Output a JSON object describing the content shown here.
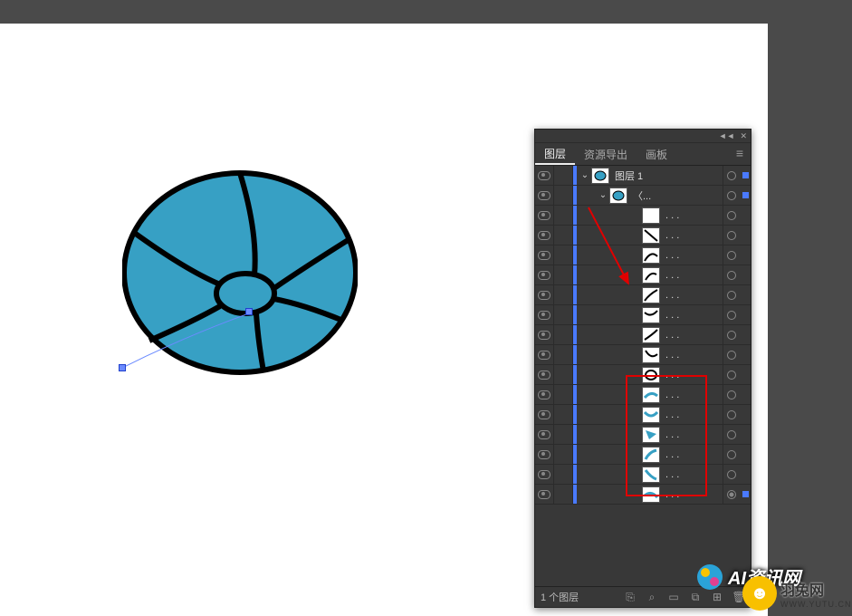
{
  "panel": {
    "tabs": [
      {
        "label": "图层",
        "active": true
      },
      {
        "label": "资源导出",
        "active": false
      },
      {
        "label": "画板",
        "active": false
      }
    ],
    "layer_count_label": "1 个图层",
    "main_layer": {
      "name": "图层 1",
      "color": "#4a7aff",
      "expanded": true,
      "selected": true
    },
    "compound": {
      "name": "〈...",
      "selected": true
    },
    "paths": [
      {
        "name": ". . .",
        "thumb": "blank"
      },
      {
        "name": ". . .",
        "thumb": "stroke1"
      },
      {
        "name": ". . .",
        "thumb": "stroke2"
      },
      {
        "name": ". . .",
        "thumb": "stroke3"
      },
      {
        "name": ". . .",
        "thumb": "stroke4"
      },
      {
        "name": ". . .",
        "thumb": "stroke5"
      },
      {
        "name": ". . .",
        "thumb": "stroke6"
      },
      {
        "name": ". . .",
        "thumb": "stroke7"
      },
      {
        "name": ". . .",
        "thumb": "ellipse"
      },
      {
        "name": ". . .",
        "thumb": "segment1"
      },
      {
        "name": ". . .",
        "thumb": "segment2"
      },
      {
        "name": ". . .",
        "thumb": "segment3"
      },
      {
        "name": ". . .",
        "thumb": "segment4"
      },
      {
        "name": ". . .",
        "thumb": "segment5"
      },
      {
        "name": ". . .",
        "thumb": "segment6",
        "selected": true
      }
    ]
  },
  "artwork": {
    "fill": "#37a0c4",
    "stroke": "#000000",
    "anchor_color": "#6b8bff"
  },
  "watermarks": {
    "w1": "AI资讯网",
    "w2_main": "羽兔网",
    "w2_sub": "WWW.YUTU.CN"
  }
}
